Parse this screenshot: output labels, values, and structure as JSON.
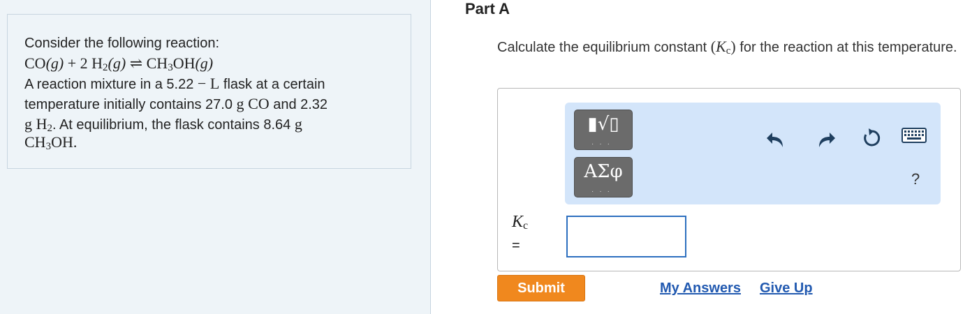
{
  "problem": {
    "intro": "Consider the following reaction:",
    "reaction": {
      "co": "CO",
      "phase1": "(g)",
      "plus": "+",
      "coef": "2",
      "h2": "H",
      "h2_sub": "2",
      "phase2": "(g)",
      "arrow": "⇌",
      "ch3oh_a": "CH",
      "ch3oh_sub": "3",
      "ch3oh_b": "OH",
      "phase3": "(g)"
    },
    "line1_a": "A reaction mixture in a 5.22",
    "line1_minus": "−",
    "line1_unit": "L",
    "line1_b": "flask at a certain",
    "line2_a": "temperature initially contains 27.0",
    "line2_g": "g",
    "line2_co": "CO",
    "line2_b": "and 2.32",
    "line3_g": "g",
    "line3_h": "H",
    "line3_sub": "2",
    "line3_b": ". At equilibrium, the flask contains 8.64",
    "line3_g2": "g",
    "line4_a": "CH",
    "line4_sub": "3",
    "line4_b": "OH."
  },
  "part": {
    "title": "Part A",
    "question_a": "Calculate the equilibrium constant",
    "question_k": "K",
    "question_k_sub": "c",
    "question_b": "for the reaction at this temperature."
  },
  "toolbar": {
    "templates_glyph": "▮√▯",
    "greek_glyph": "ΑΣφ",
    "help": "?"
  },
  "answer": {
    "label_k": "K",
    "label_sub": "c",
    "equals": "=",
    "value": ""
  },
  "actions": {
    "submit": "Submit",
    "my_answers": "My Answers",
    "give_up": "Give Up"
  },
  "colors": {
    "accent_orange": "#f0881e",
    "link_blue": "#2159b0",
    "toolbar_bg": "#d3e5fa",
    "input_border": "#2c6fbf"
  }
}
